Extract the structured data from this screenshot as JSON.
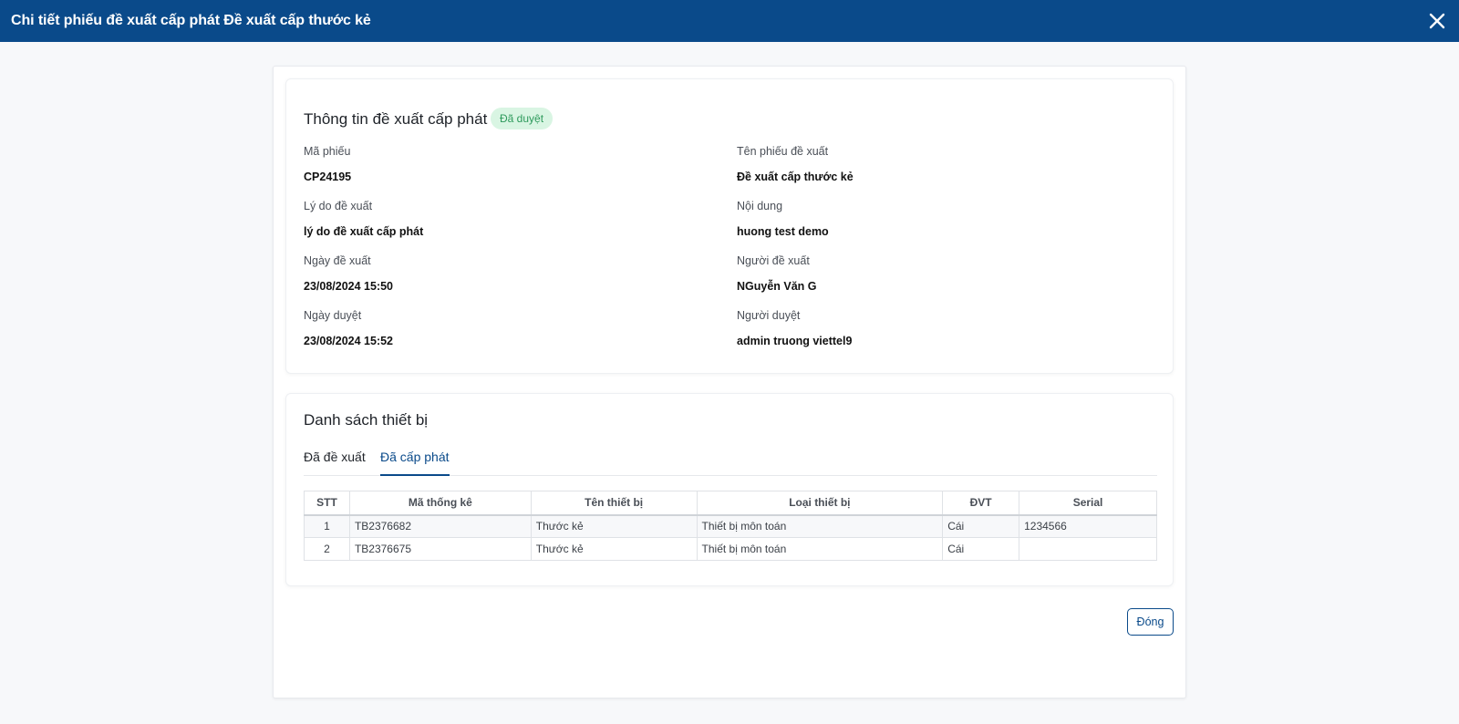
{
  "header": {
    "title": "Chi tiết phiếu đề xuất cấp phát Đề xuất cấp thước kẻ"
  },
  "info": {
    "title": "Thông tin đề xuất cấp phát",
    "status_badge": "Đã duyệt",
    "fields": {
      "ma_phieu_label": "Mã phiếu",
      "ma_phieu_value": "CP24195",
      "ten_phieu_label": "Tên phiếu đề xuất",
      "ten_phieu_value": "Đề xuất cấp thước kẻ",
      "ly_do_label": "Lý do đề xuất",
      "ly_do_value": "lý do đề xuất cấp phát",
      "noi_dung_label": "Nội dung",
      "noi_dung_value": "huong test demo",
      "ngay_de_xuat_label": "Ngày đề xuất",
      "ngay_de_xuat_value": "23/08/2024 15:50",
      "nguoi_de_xuat_label": "Người đề xuất",
      "nguoi_de_xuat_value": "NGuyễn Văn G",
      "ngay_duyet_label": "Ngày duyệt",
      "ngay_duyet_value": "23/08/2024 15:52",
      "nguoi_duyet_label": "Người duyệt",
      "nguoi_duyet_value": "admin truong viettel9"
    }
  },
  "device_list": {
    "title": "Danh sách thiết bị",
    "tabs": [
      "Đã đề xuất",
      "Đã cấp phát"
    ],
    "active_tab": "Đã cấp phát",
    "columns": [
      "STT",
      "Mã thống kê",
      "Tên thiết bị",
      "Loại thiết bị",
      "ĐVT",
      "Serial"
    ],
    "rows": [
      [
        "1",
        "TB2376682",
        "Thước kẻ",
        "Thiết bị môn toán",
        "Cái",
        "1234566"
      ],
      [
        "2",
        "TB2376675",
        "Thước kẻ",
        "Thiết bị môn toán",
        "Cái",
        ""
      ]
    ]
  },
  "footer": {
    "close_label": "Đóng"
  },
  "colors": {
    "header_bg": "#0a4a8a",
    "accent": "#0a4a8a",
    "badge_bg": "#d9f5e3",
    "badge_text": "#2e9a5c"
  },
  "icons": {
    "close": "close-icon"
  }
}
